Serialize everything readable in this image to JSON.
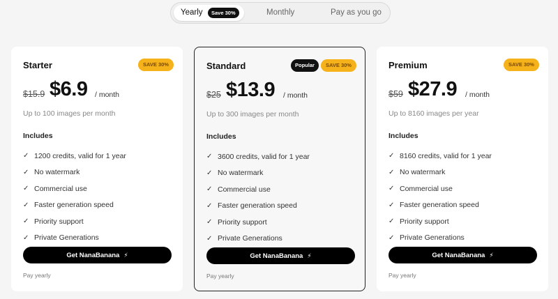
{
  "billing_toggle": {
    "yearly_label": "Yearly",
    "yearly_badge": "Save 30%",
    "monthly_label": "Monthly",
    "payg_label": "Pay as you go",
    "selected": "Yearly"
  },
  "colors": {
    "accent_badge": "#f6b21b",
    "cta_background": "#000000"
  },
  "plans": [
    {
      "name": "Starter",
      "save_badge": "SAVE 30%",
      "old_price": "$15.9",
      "price": "$6.9",
      "period": "/ month",
      "limit": "Up to 100 images per month",
      "includes_label": "Includes",
      "features": [
        "1200 credits, valid for 1 year",
        "No watermark",
        "Commercial use",
        "Faster generation speed",
        "Priority support",
        "Private Generations"
      ],
      "cta": "Get NanaBanana",
      "footnote": "Pay yearly"
    },
    {
      "name": "Standard",
      "popular_badge": "Popular",
      "save_badge": "SAVE 30%",
      "old_price": "$25",
      "price": "$13.9",
      "period": "/ month",
      "limit": "Up to 300 images per month",
      "includes_label": "Includes",
      "features": [
        "3600 credits, valid for 1 year",
        "No watermark",
        "Commercial use",
        "Faster generation speed",
        "Priority support",
        "Private Generations"
      ],
      "cta": "Get NanaBanana",
      "footnote": "Pay yearly"
    },
    {
      "name": "Premium",
      "save_badge": "SAVE 30%",
      "old_price": "$59",
      "price": "$27.9",
      "period": "/ month",
      "limit": "Up to 8160 images per year",
      "includes_label": "Includes",
      "features": [
        "8160 credits, valid for 1 year",
        "No watermark",
        "Commercial use",
        "Faster generation speed",
        "Priority support",
        "Private Generations"
      ],
      "cta": "Get NanaBanana",
      "footnote": "Pay yearly"
    }
  ]
}
